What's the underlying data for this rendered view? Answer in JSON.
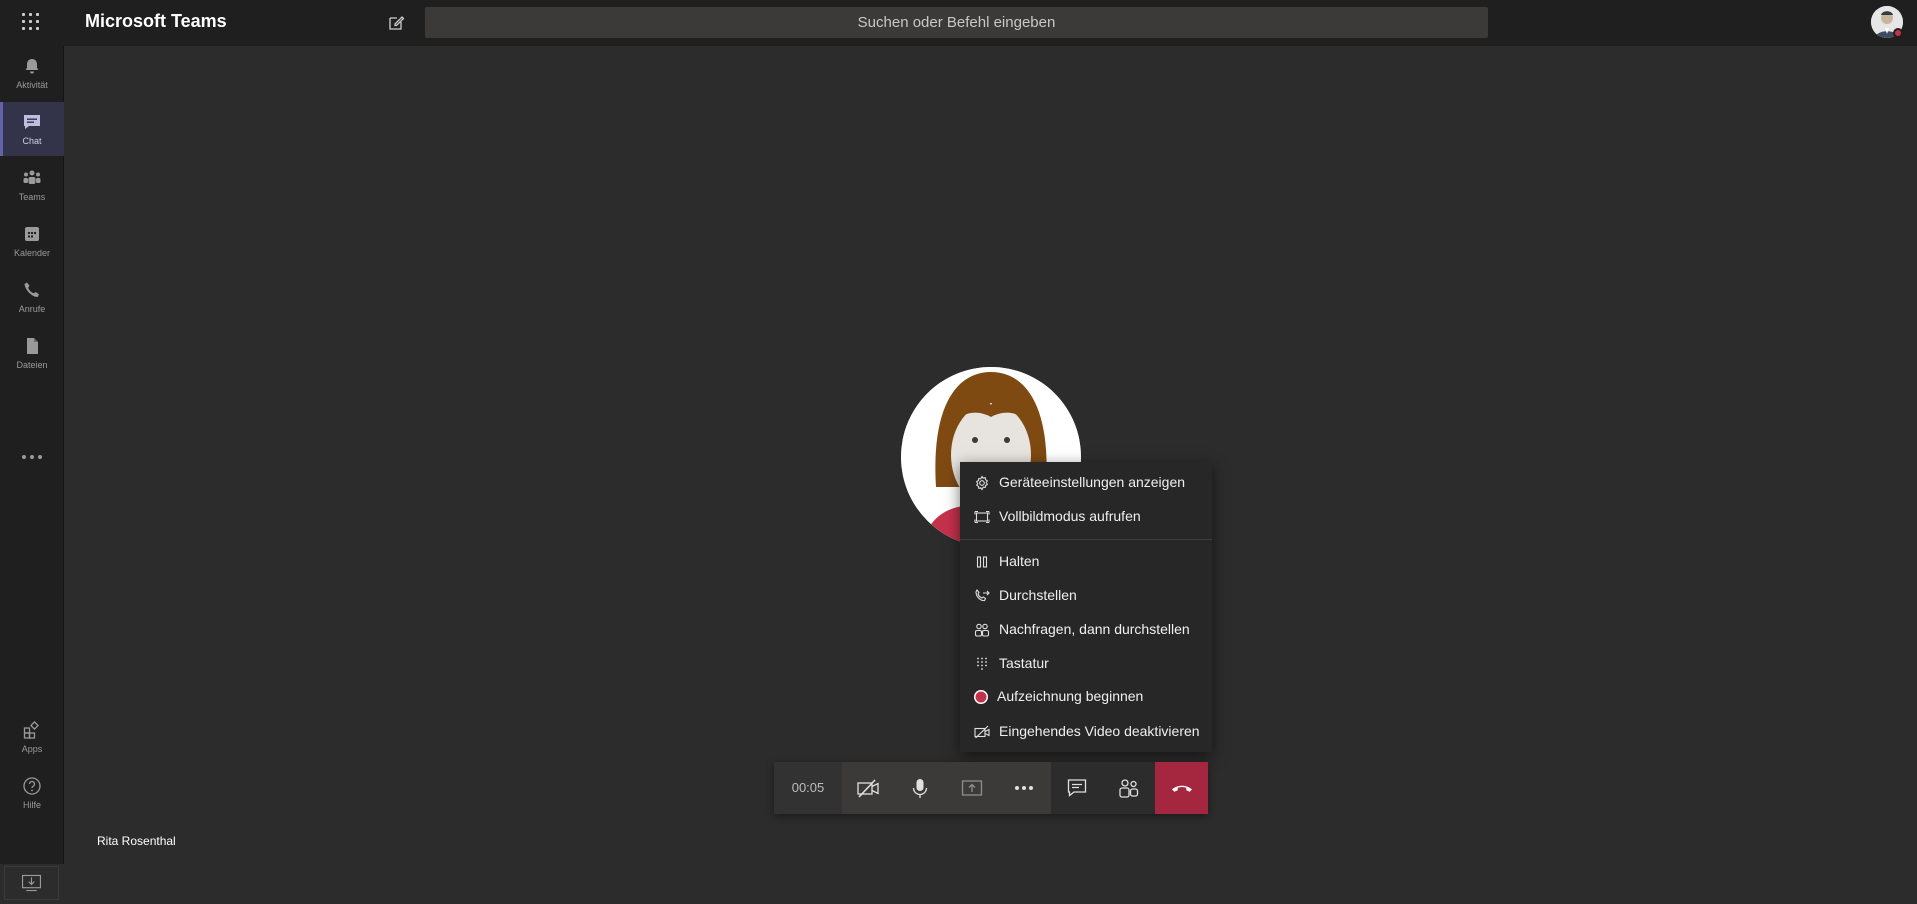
{
  "header": {
    "app_title": "Microsoft Teams",
    "search_placeholder": "Suchen oder Befehl eingeben"
  },
  "sidebar": {
    "items": [
      {
        "label": "Aktivität",
        "icon": "bell-icon"
      },
      {
        "label": "Chat",
        "icon": "chat-icon",
        "active": true
      },
      {
        "label": "Teams",
        "icon": "teams-icon"
      },
      {
        "label": "Kalender",
        "icon": "calendar-icon"
      },
      {
        "label": "Anrufe",
        "icon": "phone-icon"
      },
      {
        "label": "Dateien",
        "icon": "file-icon"
      }
    ],
    "bottom_items": [
      {
        "label": "Apps",
        "icon": "apps-icon"
      },
      {
        "label": "Hilfe",
        "icon": "help-icon"
      }
    ]
  },
  "context_menu": {
    "items": [
      {
        "label": "Geräteeinstellungen anzeigen",
        "icon": "gear-icon"
      },
      {
        "label": "Vollbildmodus aufrufen",
        "icon": "fullscreen-icon"
      },
      {
        "label": "Halten",
        "icon": "pause-icon"
      },
      {
        "label": "Durchstellen",
        "icon": "transfer-icon"
      },
      {
        "label": "Nachfragen, dann durchstellen",
        "icon": "consult-transfer-icon"
      },
      {
        "label": "Tastatur",
        "icon": "dialpad-icon"
      },
      {
        "label": "Aufzeichnung beginnen",
        "icon": "record-icon"
      },
      {
        "label": "Eingehendes Video deaktivieren",
        "icon": "video-off-icon"
      }
    ]
  },
  "call_controls": {
    "timer": "00:05",
    "buttons": [
      "camera-off-icon",
      "microphone-icon",
      "share-screen-icon",
      "more-options-icon",
      "chat-icon",
      "participants-icon",
      "hang-up-icon"
    ]
  },
  "participant": {
    "name": "Rita Rosenthal"
  },
  "colors": {
    "accent": "#6264a7",
    "hangup": "#a4263f",
    "record": "#c4314b",
    "background": "#2d2c2c"
  }
}
